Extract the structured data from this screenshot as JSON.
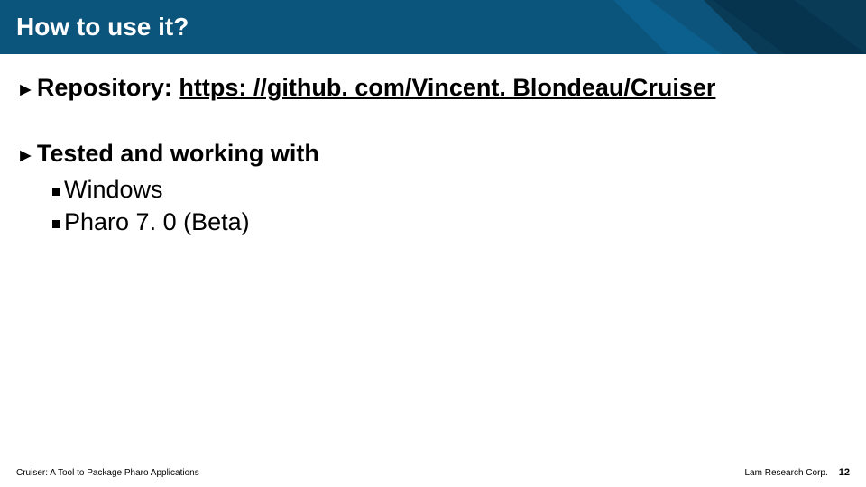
{
  "title": "How to use it?",
  "body": {
    "repo_label": "Repository:",
    "repo_url": "https: //github. com/Vincent. Blondeau/Cruiser",
    "tested_label": "Tested and working with",
    "items": [
      "Windows",
      "Pharo 7. 0 (Beta)"
    ]
  },
  "footer": {
    "left": "Cruiser: A Tool to Package Pharo Applications",
    "right": "Lam Research Corp.",
    "page": "12"
  }
}
